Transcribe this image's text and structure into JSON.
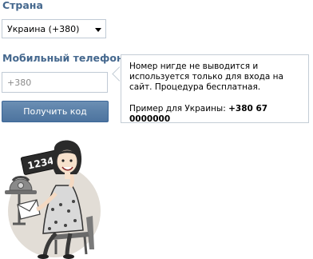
{
  "form": {
    "country_label": "Страна",
    "country_selected": "Украина (+380)",
    "phone_label": "Мобильный телефон",
    "phone_placeholder": "+380",
    "submit_label": "Получить код"
  },
  "tooltip": {
    "note": "Номер нигде не выводится и используется только для входа на сайт. Процедура бесплатная.",
    "example_prefix": "Пример для Украины:",
    "example_number": "+380 67 0000000"
  },
  "illustration": {
    "sign_text": "1234",
    "icon": "woman-holding-sign-icon"
  },
  "colors": {
    "label": "#45688e",
    "button": "#5a80a8",
    "border": "#c0cad5"
  }
}
